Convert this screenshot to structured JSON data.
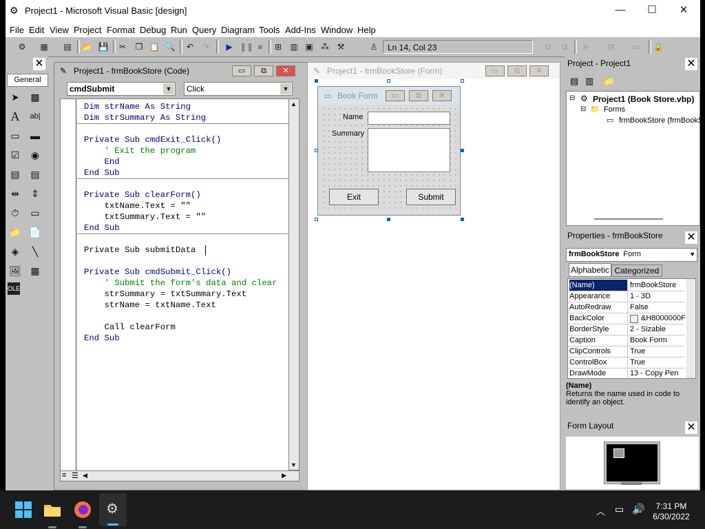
{
  "window": {
    "title": "Project1 - Microsoft Visual Basic [design]",
    "minimize": "—",
    "maximize": "☐",
    "close": "✕"
  },
  "menu": [
    "File",
    "Edit",
    "View",
    "Project",
    "Format",
    "Debug",
    "Run",
    "Query",
    "Diagram",
    "Tools",
    "Add-Ins",
    "Window",
    "Help"
  ],
  "toolbar": {
    "position": "Ln 14, Col 23"
  },
  "toolbox": {
    "tab": "General",
    "close": "✕"
  },
  "code_window": {
    "title": "Project1 - frmBookStore (Code)",
    "object_combo": "cmdSubmit",
    "proc_combo": "Click",
    "lines": {
      "l1": "Dim strName As String",
      "l2": "Dim strSummary As String",
      "l3": "Private Sub cmdExit_Click()",
      "l4": "    ' Exit the program",
      "l5": "    End",
      "l6": "End Sub",
      "l7": "Private Sub clearForm()",
      "l8": "    txtName.Text = \"\"",
      "l9": "    txtSummary.Text = \"\"",
      "l10": "End Sub",
      "l11": "Private Sub submitData",
      "l12": "Private Sub cmdSubmit_Click()",
      "l13": "    ' Submit the form's data and clear",
      "l14": "    strSummary = txtSummary.Text",
      "l15": "    strName = txtName.Text",
      "l16": "    Call clearForm",
      "l17": "End Sub"
    }
  },
  "form_window": {
    "title": "Project1 - frmBookStore (Form)",
    "form_caption": "Book Form",
    "name_label": "Name",
    "summary_label": "Summary",
    "exit_button": "Exit",
    "submit_button": "Submit"
  },
  "project_pane": {
    "title": "Project - Project1",
    "root": "Project1 (Book Store.vbp)",
    "folder": "Forms",
    "form": "frmBookStore (frmBookS"
  },
  "properties_pane": {
    "title": "Properties - frmBookStore",
    "object_name": "frmBookStore",
    "object_type": "Form",
    "tab_alpha": "Alphabetic",
    "tab_cat": "Categorized",
    "rows": [
      {
        "name": "(Name)",
        "value": "frmBookStore"
      },
      {
        "name": "Appearance",
        "value": "1 - 3D"
      },
      {
        "name": "AutoRedraw",
        "value": "False"
      },
      {
        "name": "BackColor",
        "value": "&H8000000F"
      },
      {
        "name": "BorderStyle",
        "value": "2 - Sizable"
      },
      {
        "name": "Caption",
        "value": "Book Form"
      },
      {
        "name": "ClipControls",
        "value": "True"
      },
      {
        "name": "ControlBox",
        "value": "True"
      },
      {
        "name": "DrawMode",
        "value": "13 - Copy Pen"
      }
    ],
    "desc_title": "(Name)",
    "desc_text": "Returns the name used in code to identify an object."
  },
  "layout_pane": {
    "title": "Form Layout"
  },
  "taskbar": {
    "time": "7:31 PM",
    "date": "6/30/2022"
  },
  "colors": {
    "selection": "#0a246a",
    "keyword": "#00007f",
    "comment": "#007f00"
  }
}
